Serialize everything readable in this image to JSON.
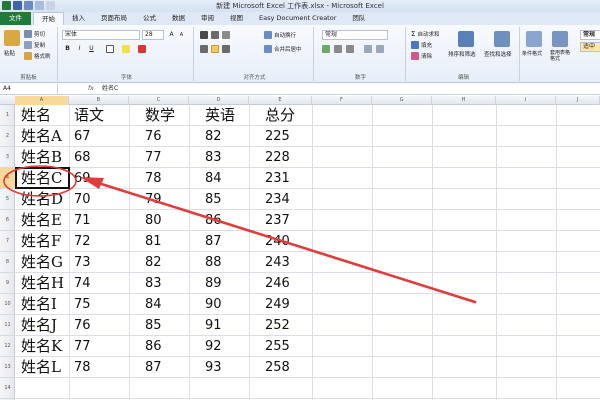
{
  "window": {
    "title": "新建 Microsoft Excel 工作表.xlsx - Microsoft Excel"
  },
  "tabs": [
    "文件",
    "开始",
    "插入",
    "页面布局",
    "公式",
    "数据",
    "审阅",
    "视图",
    "Easy Document Creator",
    "团队"
  ],
  "active_tab": "开始",
  "ribbon": {
    "clipboard": {
      "paste": "粘贴",
      "cut": "剪切",
      "copy": "复制",
      "format_painter": "格式刷",
      "label": "剪贴板"
    },
    "font": {
      "name": "宋体",
      "size": "28",
      "bold": "B",
      "italic": "I",
      "underline": "U",
      "grow": "A",
      "shrink": "A",
      "label": "字体"
    },
    "alignment": {
      "wrap": "自动换行",
      "merge": "合并后居中",
      "label": "对齐方式"
    },
    "number": {
      "format": "常规",
      "label": "数字"
    },
    "editing": {
      "autosum": "自动求和",
      "fill": "填充",
      "clear": "清除",
      "sort": "排序和筛选",
      "find": "查找和选择",
      "label": "编辑"
    },
    "styles": {
      "conditional": "条件格式",
      "table": "套用表格格式",
      "normal": "常规",
      "medium": "适中"
    }
  },
  "formula_bar": {
    "name_box": "A4",
    "fx": "fx",
    "value": "姓名C"
  },
  "columns": [
    "A",
    "B",
    "C",
    "D",
    "E",
    "F",
    "G",
    "H",
    "I",
    "J"
  ],
  "rows": [
    "1",
    "2",
    "3",
    "4",
    "5",
    "6",
    "7",
    "8",
    "9",
    "10",
    "11",
    "12",
    "13",
    "14"
  ],
  "selected_cell": "A4",
  "sheet": {
    "header": [
      "姓名",
      "语文",
      "数学",
      "英语",
      "总分"
    ],
    "data": [
      [
        "姓名A",
        "67",
        "76",
        "82",
        "225"
      ],
      [
        "姓名B",
        "68",
        "77",
        "83",
        "228"
      ],
      [
        "姓名C",
        "69",
        "78",
        "84",
        "231"
      ],
      [
        "姓名D",
        "70",
        "79",
        "85",
        "234"
      ],
      [
        "姓名E",
        "71",
        "80",
        "86",
        "237"
      ],
      [
        "姓名F",
        "72",
        "81",
        "87",
        "240"
      ],
      [
        "姓名G",
        "73",
        "82",
        "88",
        "243"
      ],
      [
        "姓名H",
        "74",
        "83",
        "89",
        "246"
      ],
      [
        "姓名I",
        "75",
        "84",
        "90",
        "249"
      ],
      [
        "姓名J",
        "76",
        "85",
        "91",
        "252"
      ],
      [
        "姓名K",
        "77",
        "86",
        "92",
        "255"
      ],
      [
        "姓名L",
        "78",
        "87",
        "93",
        "258"
      ]
    ]
  },
  "annotation": {
    "color": "#e23b3b"
  }
}
